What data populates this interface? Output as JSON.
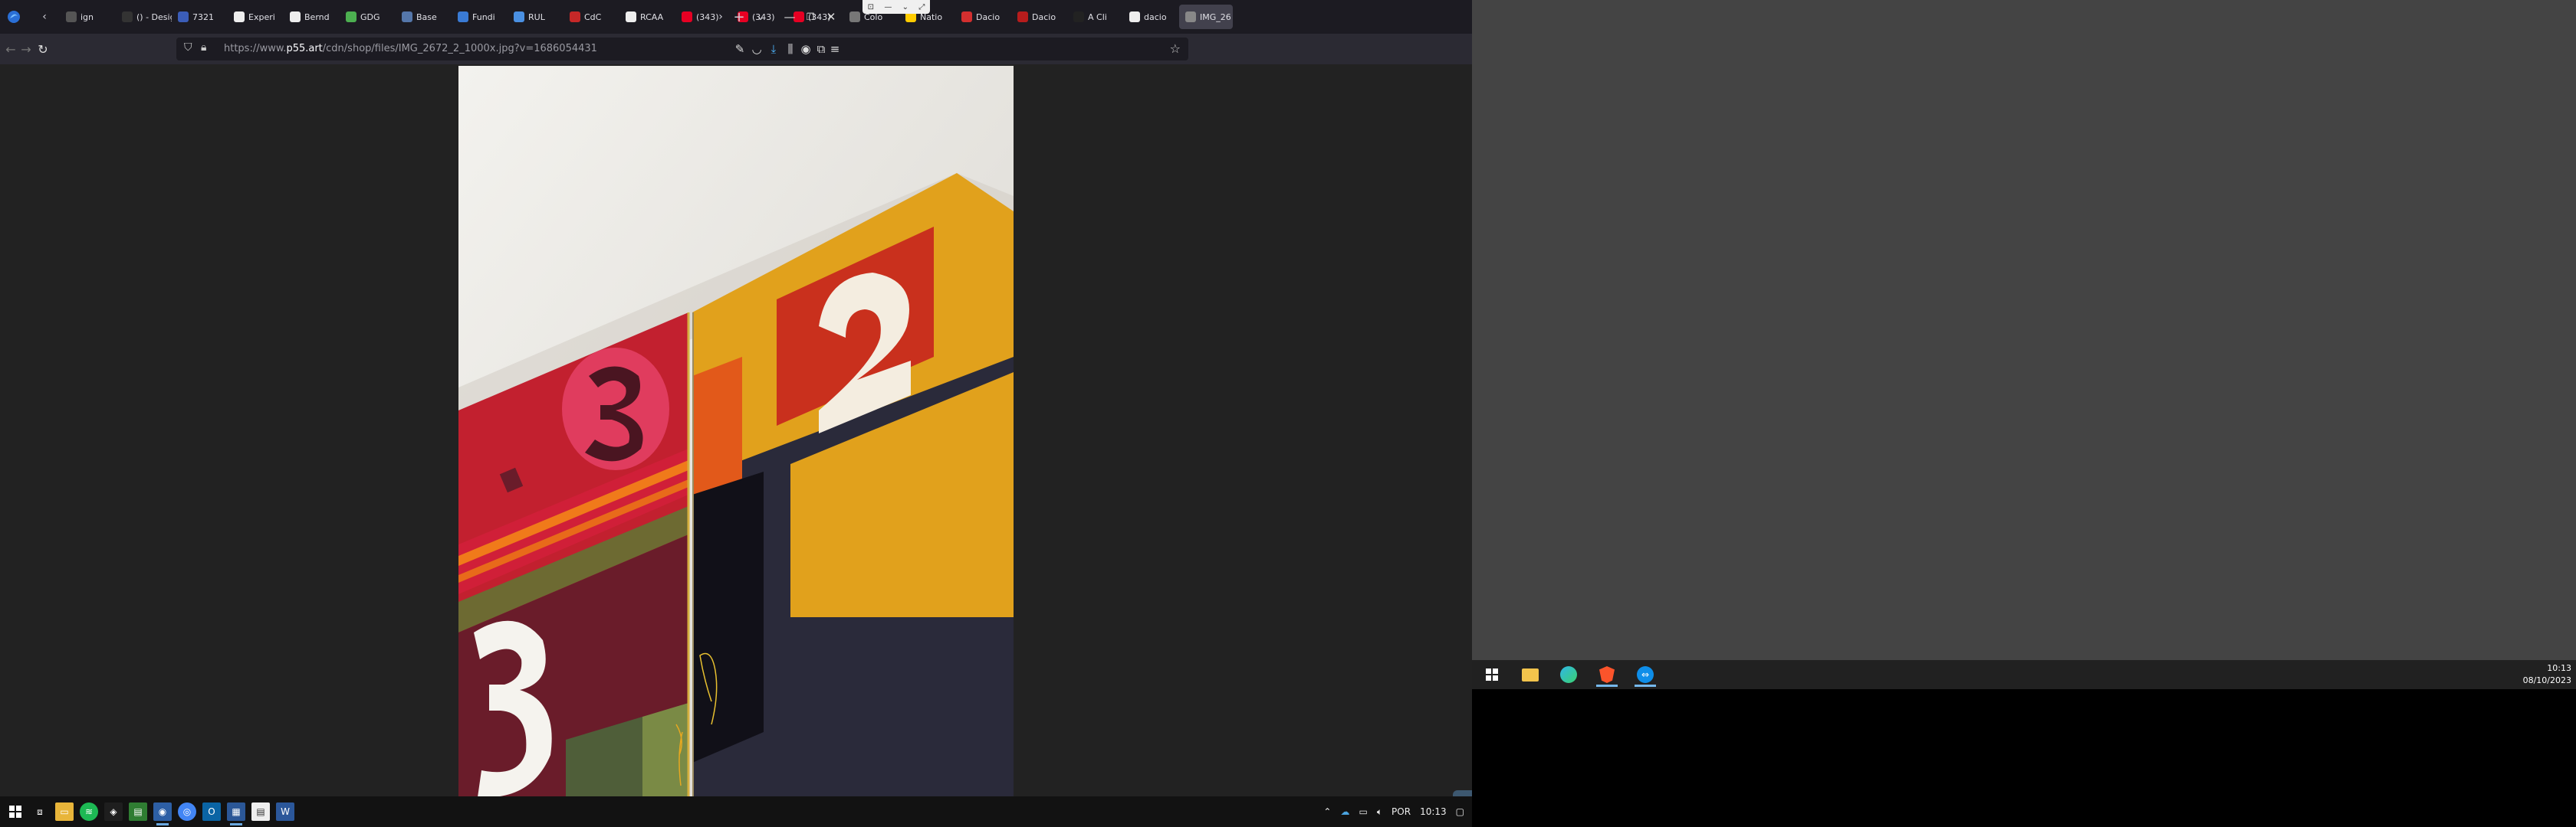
{
  "browser": {
    "tabs": [
      {
        "label": "ign",
        "favicon": "doc-icon",
        "color": "#555"
      },
      {
        "label": "() - Design",
        "favicon": "code-icon",
        "color": "#333"
      },
      {
        "label": "7321",
        "favicon": "db-icon",
        "color": "#3b5db8"
      },
      {
        "label": "Experi",
        "favicon": "g-icon",
        "color": "#eee"
      },
      {
        "label": "Bernd",
        "favicon": "g-icon",
        "color": "#eee"
      },
      {
        "label": "GDG",
        "favicon": "gdg-icon",
        "color": "#4caf50"
      },
      {
        "label": "Base",
        "favicon": "base-icon",
        "color": "#5577aa"
      },
      {
        "label": "Fundi",
        "favicon": "wave-icon",
        "color": "#3a7bd5"
      },
      {
        "label": "RUL",
        "favicon": "flag-icon",
        "color": "#4a90e2"
      },
      {
        "label": "CdC",
        "favicon": "cdc-icon",
        "color": "#c62828"
      },
      {
        "label": "RCAA",
        "favicon": "rca-icon",
        "color": "#eee"
      },
      {
        "label": "(343)",
        "favicon": "pinterest-icon",
        "color": "#e60023"
      },
      {
        "label": "(343)",
        "favicon": "pinterest-icon",
        "color": "#e60023"
      },
      {
        "label": "(343)",
        "favicon": "pinterest-icon",
        "color": "#e60023"
      },
      {
        "label": "Colo",
        "favicon": "color-icon",
        "color": "#777"
      },
      {
        "label": "Natio",
        "favicon": "ng-icon",
        "color": "#ffcc00"
      },
      {
        "label": "Dacio",
        "favicon": "dacio-icon",
        "color": "#d32f2f"
      },
      {
        "label": "Dacio",
        "favicon": "dacio-icon",
        "color": "#b71c1c"
      },
      {
        "label": "A Cli",
        "favicon": "a-icon",
        "color": "#222"
      },
      {
        "label": "dacio",
        "favicon": "g-icon",
        "color": "#eee"
      },
      {
        "label": "IMG_26",
        "favicon": "image-icon",
        "color": "#888",
        "active": true
      }
    ],
    "url_prefix": "https://www.",
    "url_domain": "p55.art",
    "url_path": "/cdn/shop/files/IMG_2672_2_1000x.jpg?v=1686054431"
  },
  "photo": {
    "description_icon": "artwork-photo",
    "digits": [
      "3",
      "2",
      "3"
    ]
  },
  "taskbar1": {
    "language": "POR",
    "time": "10:13"
  },
  "taskbar2": {
    "time": "10:13",
    "date": "08/10/2023"
  }
}
